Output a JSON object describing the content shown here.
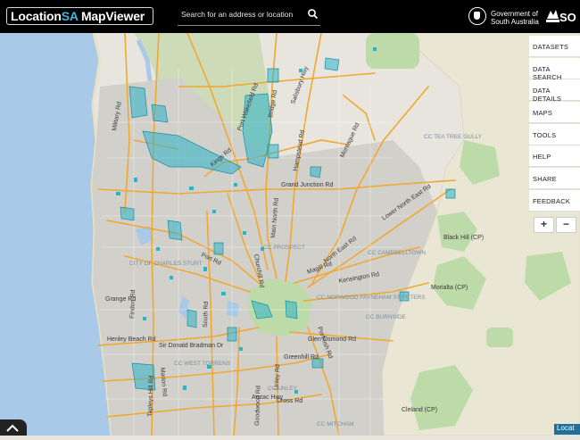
{
  "header": {
    "logo_location": "Location",
    "logo_sa": "SA",
    "logo_mapviewer": " MapViewer",
    "search_placeholder": "Search for an address or location",
    "govt_line1": "Government of",
    "govt_line2": "South Australia",
    "sa_logo_text": "SO"
  },
  "menu": {
    "items": [
      "DATASETS",
      "DATA SEARCH",
      "DATA DETAILS",
      "MAPS",
      "TOOLS",
      "HELP",
      "SHARE",
      "FEEDBACK"
    ]
  },
  "zoom": {
    "in_label": "+",
    "out_label": "−"
  },
  "attribution": "Locat",
  "map": {
    "road_labels": [
      "Grand Junction Rd",
      "Main North Rd",
      "North East Rd",
      "Lower North East Rd",
      "Port Wakefield Rd",
      "Churchill Rd",
      "Portrush Rd",
      "Greenhill Rd",
      "Glen Osmond Rd",
      "Sir Donald Bradman Dr",
      "Anzac Hwy",
      "Cross Rd",
      "Marion Rd",
      "Tapleys Hill Rd",
      "Port Rd",
      "Kensington Rd",
      "Magill Rd",
      "Montague Rd",
      "Findon Rd",
      "Grange Rd",
      "Henley Beach Rd",
      "Military Rd",
      "Salisbury Hwy",
      "Bridge Rd",
      "Hampstead Rd",
      "Kings Rd",
      "South Rd",
      "Goodwood Rd",
      "Unley Rd"
    ],
    "place_labels": [
      "CC PROSPECT",
      "CC CAMPBELLTOWN",
      "CC NORWOOD PAYNEHAM ST PETERS",
      "CC UNLEY",
      "CC WEST TORRENS",
      "CC TEA TREE GULLY",
      "CITY OF CHARLES STURT",
      "Black Hill (CP)",
      "Morialta (CP)",
      "Cleland (CP)",
      "CC MITCHAM",
      "CC BURNSIDE"
    ]
  },
  "colors": {
    "header_bg": "#000000",
    "road": "#f0a830",
    "water": "#a8c8e6",
    "park": "#a9d49b",
    "dataset": "#2bb3c8",
    "urban": "#c8c6c2"
  }
}
